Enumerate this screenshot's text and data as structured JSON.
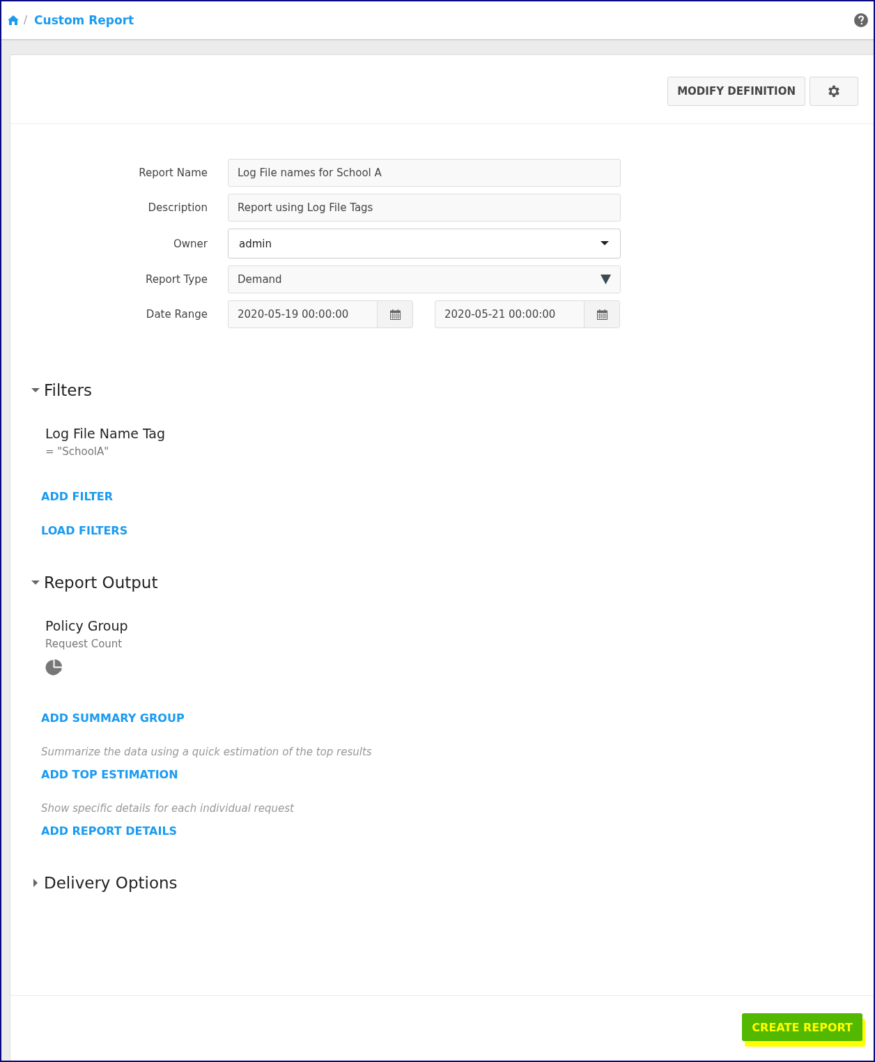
{
  "breadcrumb": {
    "separator": "/",
    "title": "Custom Report"
  },
  "toolbar": {
    "buttons": [
      "MODIFY DEFINITION"
    ]
  },
  "form": {
    "fields": [
      {
        "label": "Report Name",
        "kind": "text",
        "value": "Log File names for School A"
      },
      {
        "label": "Description",
        "kind": "text",
        "value": "Report using Log File Tags"
      },
      {
        "label": "Owner",
        "kind": "dropdown",
        "value": "admin"
      },
      {
        "label": "Report Type",
        "kind": "native-select",
        "value": "Demand"
      },
      {
        "label": "Date Range",
        "kind": "date-range",
        "values": [
          "2020-05-19 00:00:00",
          "2020-05-21 00:00:00"
        ]
      }
    ]
  },
  "sections": [
    {
      "title": "Filters",
      "expanded": true,
      "items": [
        {
          "kind": "filter",
          "title": "Log File Name Tag",
          "subtitle": "= \"SchoolA\""
        }
      ],
      "actions": [
        {
          "label": "ADD FILTER"
        },
        {
          "label": "LOAD FILTERS"
        }
      ]
    },
    {
      "title": "Report Output",
      "expanded": true,
      "items": [
        {
          "kind": "summary",
          "title": "Policy Group",
          "subtitle": "Request Count"
        }
      ],
      "actions": [
        {
          "label": "ADD SUMMARY GROUP"
        },
        {
          "hint": "Summarize the data using a quick estimation of the top results",
          "label": "ADD TOP ESTIMATION"
        },
        {
          "hint": "Show specific details for each individual request",
          "label": "ADD REPORT DETAILS"
        }
      ]
    },
    {
      "title": "Delivery Options",
      "expanded": false
    }
  ],
  "footer": {
    "button": "CREATE REPORT"
  }
}
